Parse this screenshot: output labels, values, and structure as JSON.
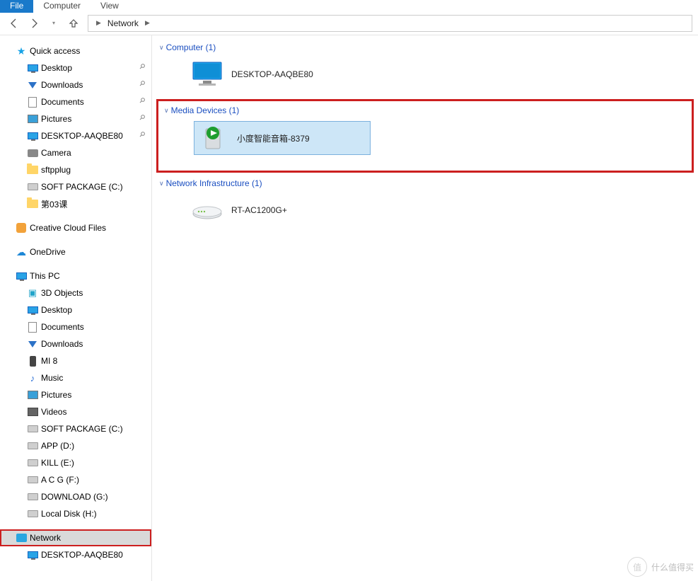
{
  "ribbon": {
    "tabs": [
      "File",
      "Computer",
      "View"
    ]
  },
  "breadcrumb": {
    "root": "Network"
  },
  "sidebar": {
    "quick_access": "Quick access",
    "quick_items": [
      {
        "label": "Desktop",
        "icon": "monitor",
        "pin": true
      },
      {
        "label": "Downloads",
        "icon": "down",
        "pin": true
      },
      {
        "label": "Documents",
        "icon": "doc",
        "pin": true
      },
      {
        "label": "Pictures",
        "icon": "pic",
        "pin": true
      },
      {
        "label": "DESKTOP-AAQBE80",
        "icon": "monitor",
        "pin": true
      },
      {
        "label": "Camera",
        "icon": "camera",
        "pin": false
      },
      {
        "label": "sftpplug",
        "icon": "folder",
        "pin": false
      },
      {
        "label": "SOFT PACKAGE (C:)",
        "icon": "drive",
        "pin": false
      },
      {
        "label": "第03课",
        "icon": "folder",
        "pin": false
      }
    ],
    "creative_cloud": "Creative Cloud Files",
    "onedrive": "OneDrive",
    "this_pc": "This PC",
    "pc_items": [
      {
        "label": "3D Objects",
        "icon": "3d"
      },
      {
        "label": "Desktop",
        "icon": "monitor"
      },
      {
        "label": "Documents",
        "icon": "doc"
      },
      {
        "label": "Downloads",
        "icon": "down"
      },
      {
        "label": "MI 8",
        "icon": "phone"
      },
      {
        "label": "Music",
        "icon": "music"
      },
      {
        "label": "Pictures",
        "icon": "pic"
      },
      {
        "label": "Videos",
        "icon": "video"
      },
      {
        "label": "SOFT PACKAGE (C:)",
        "icon": "drive"
      },
      {
        "label": "APP (D:)",
        "icon": "drive"
      },
      {
        "label": "KILL (E:)",
        "icon": "drive"
      },
      {
        "label": "A C G  (F:)",
        "icon": "drive"
      },
      {
        "label": "DOWNLOAD  (G:)",
        "icon": "drive"
      },
      {
        "label": "Local Disk (H:)",
        "icon": "drive"
      }
    ],
    "network": "Network",
    "network_items": [
      {
        "label": "DESKTOP-AAQBE80",
        "icon": "monitor"
      }
    ]
  },
  "content": {
    "groups": [
      {
        "header": "Computer (1)",
        "items": [
          {
            "label": "DESKTOP-AAQBE80",
            "icon": "pc"
          }
        ],
        "selected": false,
        "annot": false
      },
      {
        "header": "Media Devices (1)",
        "items": [
          {
            "label": "小度智能音箱-8379",
            "icon": "media"
          }
        ],
        "selected": true,
        "annot": true
      },
      {
        "header": "Network Infrastructure (1)",
        "items": [
          {
            "label": "RT-AC1200G+",
            "icon": "router"
          }
        ],
        "selected": false,
        "annot": false
      }
    ]
  },
  "watermark": {
    "brand": "值",
    "text": "什么值得买"
  }
}
